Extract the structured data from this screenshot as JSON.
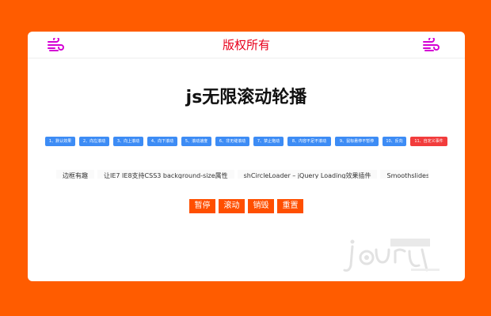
{
  "header": {
    "title": "版权所有",
    "left_icon": "wind-icon",
    "right_icon": "wind-icon",
    "accent_color": "#e8001c",
    "icon_color": "#d400d4"
  },
  "main": {
    "title": "js无限滚动轮播"
  },
  "demo_buttons": [
    {
      "label": "1、默认效果",
      "active": false
    },
    {
      "label": "2、向左滚动",
      "active": false
    },
    {
      "label": "3、向上滚动",
      "active": false
    },
    {
      "label": "4、向下滚动",
      "active": false
    },
    {
      "label": "5、滚动速度",
      "active": false
    },
    {
      "label": "6、非无缝滚动",
      "active": false
    },
    {
      "label": "7、禁止拖动",
      "active": false
    },
    {
      "label": "8、内容不足不滚动",
      "active": false
    },
    {
      "label": "9、鼠标悬停不暂停",
      "active": false
    },
    {
      "label": "10、反向",
      "active": false
    },
    {
      "label": "11、自定义事件",
      "active": true
    }
  ],
  "marquee": {
    "items": [
      "边框有趣",
      "让IE7 IE8支持CSS3 background-size属性",
      "shCircleLoader – jQuery Loading效果插件",
      "Smoothslides – 丽"
    ]
  },
  "controls": {
    "pause_label": "暂停",
    "scroll_label": "滚动",
    "destroy_label": "销毁",
    "reset_label": "重置"
  },
  "colors": {
    "page_background": "#ff5c00",
    "demo_button": "#3d8cf5",
    "demo_button_active": "#f23c3c",
    "control_button": "#ff4f00"
  },
  "watermark": {
    "logo": "jquery-plugin-library-logo"
  }
}
